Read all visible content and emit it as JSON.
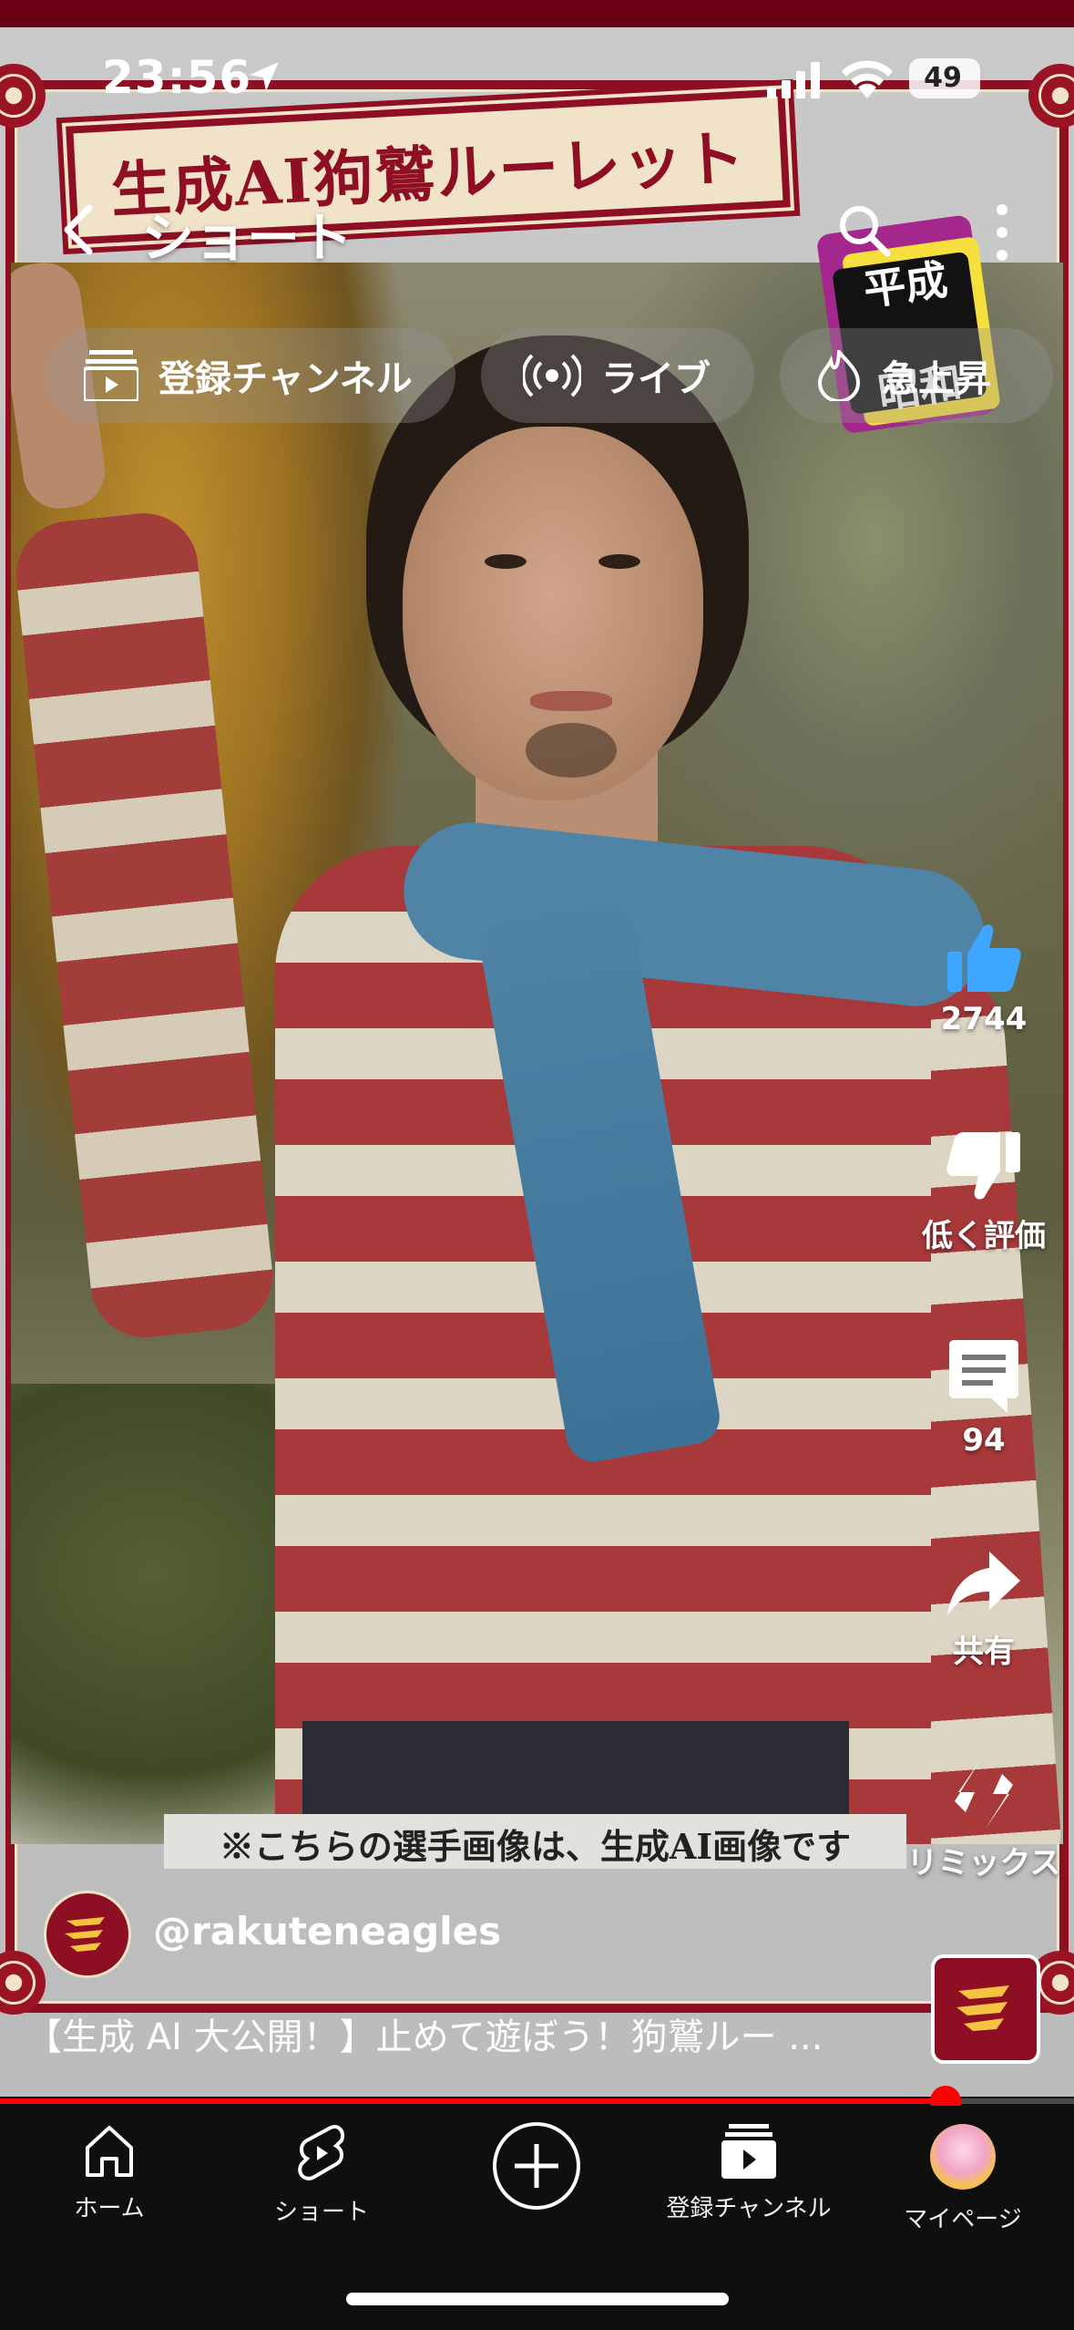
{
  "status_bar": {
    "time": "23:56",
    "battery": "49"
  },
  "header": {
    "title": "ショート"
  },
  "chips": [
    {
      "label": "登録チャンネル",
      "icon": "subscriptions-icon"
    },
    {
      "label": "ライブ",
      "icon": "live-icon"
    },
    {
      "label": "急上昇",
      "icon": "trending-icon"
    }
  ],
  "video": {
    "sign_text": "生成AI狗鷲ルーレット",
    "badge_top": "平成",
    "badge_bottom": "昭和",
    "caption": "※こちらの選手画像は、生成AI画像です",
    "channel": "@rakuteneagles",
    "description": "【生成 AI 大公開！】止めて遊ぼう！狗鷲ルー ...",
    "progress": 0.88
  },
  "actions": {
    "like_count": "2744",
    "dislike_label": "低く評価",
    "comment_count": "94",
    "share_label": "共有",
    "remix_label": "リミックス"
  },
  "bottom_nav": {
    "home": "ホーム",
    "shorts": "ショート",
    "subscriptions": "登録チャンネル",
    "you": "マイページ"
  },
  "colors": {
    "accent": "#ff0000",
    "eagles_red": "#8e0f23"
  }
}
